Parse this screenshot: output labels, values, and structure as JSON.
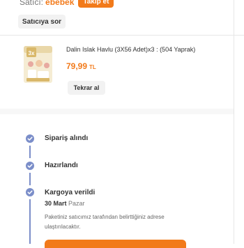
{
  "seller": {
    "prefix": "Satıcı:",
    "name": "ebebek",
    "follow_label": "Takip et"
  },
  "ask_seller_label": "Satıcıya sor",
  "product": {
    "title": "Dalin Islak Havlu (3X56 Adet)x3 : (504 Yaprak)",
    "image_label": "3x",
    "price": "79,99",
    "currency": "TL",
    "reorder_label": "Tekrar al"
  },
  "timeline": {
    "steps": [
      {
        "label": "Sipariş alındı"
      },
      {
        "label": "Hazırlandı"
      },
      {
        "label": "Kargoya verildi",
        "date": "30 Mart",
        "day": "Pazar",
        "note": "Paketiniz satıcımız tarafından belirttiğiniz adrese ulaştırılacaktır."
      }
    ]
  },
  "colors": {
    "accent": "#f27a1a",
    "step": "#7b8ec9"
  },
  "icons": {
    "step": "check-circle-icon"
  }
}
